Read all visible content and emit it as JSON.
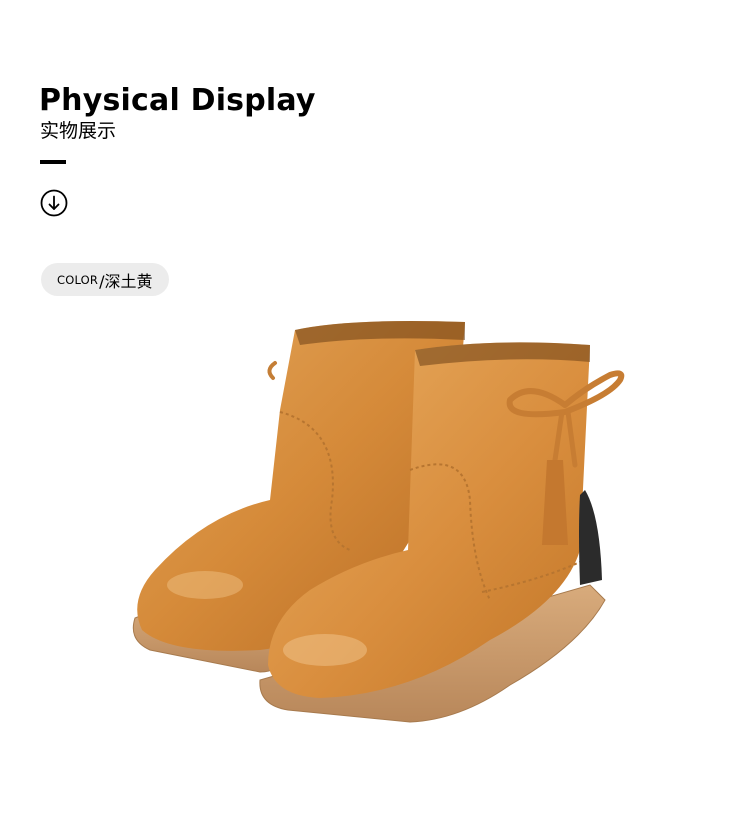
{
  "section": {
    "title": "Physical Display",
    "subtitle": "实物展示"
  },
  "color": {
    "label": "COLOR",
    "value": "/深土黄"
  },
  "product_image": {
    "subject": "Pair of tan leather ankle boots with suede bow and tassel",
    "primary_color": "#d88f3e",
    "sole_color": "#c99a6a",
    "tassel_color": "#2b2b2b"
  },
  "icons": {
    "scroll": "arrow-down-circle-icon"
  }
}
